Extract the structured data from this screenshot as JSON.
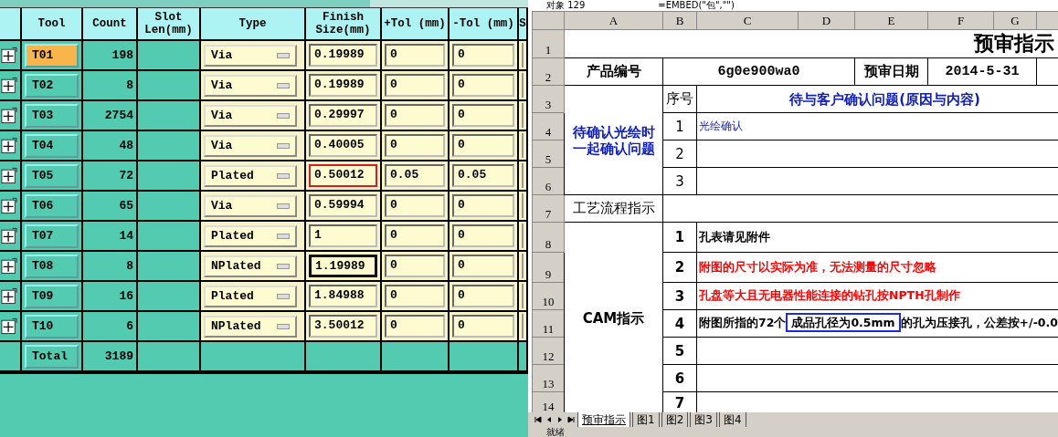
{
  "drill_table": {
    "columns": [
      "Tool",
      "Count",
      "Slot Len(mm)",
      "Type",
      "Finish Size(mm)",
      "+Tol (mm)",
      "-Tol (mm)",
      "S"
    ],
    "rows": [
      {
        "tool": "T01",
        "selected": true,
        "count": "198",
        "type": "Via",
        "finish": "0.19989",
        "plus_tol": "0",
        "minus_tol": "0",
        "highlighted": false,
        "focused": false
      },
      {
        "tool": "T02",
        "selected": false,
        "count": "8",
        "type": "Via",
        "finish": "0.19989",
        "plus_tol": "0",
        "minus_tol": "0",
        "highlighted": false,
        "focused": false
      },
      {
        "tool": "T03",
        "selected": false,
        "count": "2754",
        "type": "Via",
        "finish": "0.29997",
        "plus_tol": "0",
        "minus_tol": "0",
        "highlighted": false,
        "focused": false
      },
      {
        "tool": "T04",
        "selected": false,
        "count": "48",
        "type": "Via",
        "finish": "0.40005",
        "plus_tol": "0",
        "minus_tol": "0",
        "highlighted": false,
        "focused": false
      },
      {
        "tool": "T05",
        "selected": false,
        "count": "72",
        "type": "Plated",
        "finish": "0.50012",
        "plus_tol": "0.05",
        "minus_tol": "0.05",
        "highlighted": true,
        "focused": false
      },
      {
        "tool": "T06",
        "selected": false,
        "count": "65",
        "type": "Via",
        "finish": "0.59994",
        "plus_tol": "0",
        "minus_tol": "0",
        "highlighted": false,
        "focused": false
      },
      {
        "tool": "T07",
        "selected": false,
        "count": "14",
        "type": "Plated",
        "finish": "1",
        "plus_tol": "0",
        "minus_tol": "0",
        "highlighted": false,
        "focused": false
      },
      {
        "tool": "T08",
        "selected": false,
        "count": "8",
        "type": "NPlated",
        "finish": "1.19989",
        "plus_tol": "0",
        "minus_tol": "0",
        "highlighted": false,
        "focused": true
      },
      {
        "tool": "T09",
        "selected": false,
        "count": "16",
        "type": "Plated",
        "finish": "1.84988",
        "plus_tol": "0",
        "minus_tol": "0",
        "highlighted": false,
        "focused": false
      },
      {
        "tool": "T10",
        "selected": false,
        "count": "6",
        "type": "NPlated",
        "finish": "3.50012",
        "plus_tol": "0",
        "minus_tol": "0",
        "highlighted": false,
        "focused": false
      }
    ],
    "total": {
      "label": "Total",
      "count": "3189"
    }
  },
  "spreadsheet": {
    "name_box": "对象 129",
    "formula": "=EMBED(\"包\",\"\")",
    "column_headers": [
      "A",
      "B",
      "C",
      "D",
      "E",
      "F",
      "G"
    ],
    "row_headers": [
      "1",
      "2",
      "3",
      "4",
      "5",
      "6",
      "7",
      "8",
      "9",
      "10",
      "11",
      "12",
      "13",
      "14"
    ],
    "title": "预审指示",
    "product_label": "产品编号",
    "product_no": "6g0e900wa0",
    "date_label": "预审日期",
    "date": "2014-5-31",
    "confirm_section": {
      "label": "待确认光绘时一起确认问题",
      "seq_header": "序号",
      "issues_header": "待与客户确认问题(原因与内容)",
      "items": [
        {
          "no": "1",
          "text": "光绘确认"
        },
        {
          "no": "2"
        },
        {
          "no": "3"
        }
      ]
    },
    "process_label": "工艺流程指示",
    "cam_section": {
      "label": "CAM指示",
      "items": [
        {
          "no": "1",
          "color": "#000000",
          "segments": [
            {
              "text": "孔表请见附件",
              "boxed": false
            }
          ]
        },
        {
          "no": "2",
          "color": "#ff0000",
          "segments": [
            {
              "text": "附图的尺寸以实际为准，无法测量的尺寸忽略",
              "boxed": false
            }
          ]
        },
        {
          "no": "3",
          "color": "#ff0000",
          "segments": [
            {
              "text": "孔盘等大且无电器性能连接的钻孔按NPTH孔制作",
              "boxed": false
            }
          ]
        },
        {
          "no": "4",
          "color": "#000000",
          "segments": [
            {
              "text": "附图所指的72个",
              "boxed": false
            },
            {
              "text": "成品孔径为0.5mm",
              "boxed": true
            },
            {
              "text": "的孔为压接孔，公差按+/-0.0",
              "boxed": false
            }
          ]
        },
        {
          "no": "5"
        },
        {
          "no": "6"
        },
        {
          "no": "7"
        }
      ]
    },
    "sheet_tabs": [
      {
        "label": "预审指示",
        "selected": true
      },
      {
        "label": "图1",
        "selected": false
      },
      {
        "label": "图2",
        "selected": false
      },
      {
        "label": "图3",
        "selected": false
      },
      {
        "label": "图4",
        "selected": false
      }
    ],
    "status": "就绪"
  }
}
